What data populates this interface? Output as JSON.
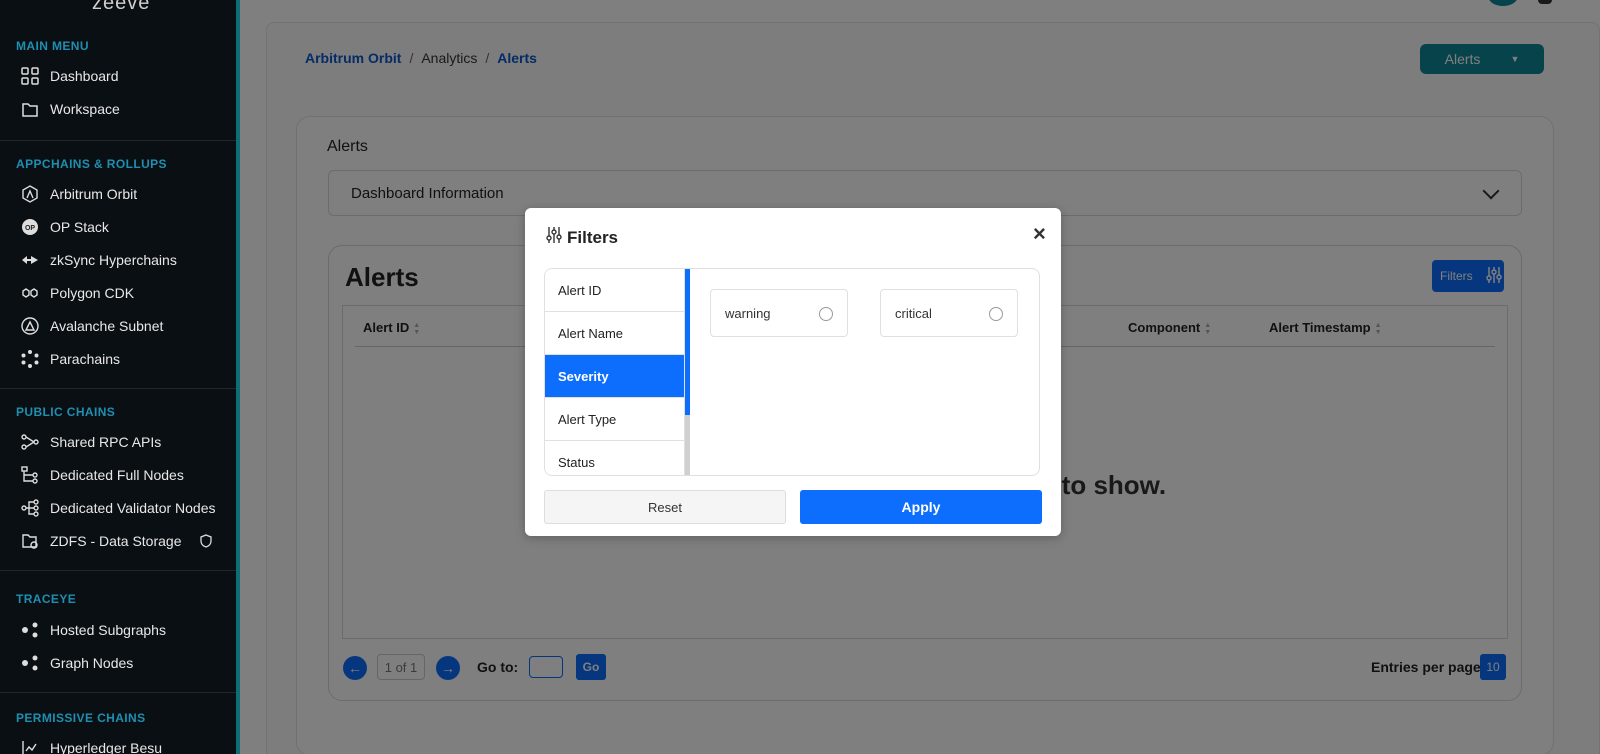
{
  "app": {
    "logo_text": "zeeve"
  },
  "sidebar": {
    "sections": [
      {
        "title": "MAIN MENU",
        "items": [
          {
            "label": "Dashboard",
            "icon": "grid-icon"
          },
          {
            "label": "Workspace",
            "icon": "folder-icon"
          }
        ]
      },
      {
        "title": "APPCHAINS & ROLLUPS",
        "items": [
          {
            "label": "Arbitrum Orbit",
            "icon": "arbitrum-icon"
          },
          {
            "label": "OP Stack",
            "icon": "op-icon"
          },
          {
            "label": "zkSync Hyperchains",
            "icon": "zksync-icon"
          },
          {
            "label": "Polygon CDK",
            "icon": "polygon-icon"
          },
          {
            "label": "Avalanche Subnet",
            "icon": "avalanche-icon"
          },
          {
            "label": "Parachains",
            "icon": "polkadot-icon"
          }
        ]
      },
      {
        "title": "PUBLIC CHAINS",
        "items": [
          {
            "label": "Shared RPC APIs",
            "icon": "rpc-icon"
          },
          {
            "label": "Dedicated Full Nodes",
            "icon": "full-nodes-icon"
          },
          {
            "label": "Dedicated Validator Nodes",
            "icon": "validator-icon"
          },
          {
            "label": "ZDFS - Data Storage",
            "icon": "storage-icon"
          }
        ]
      },
      {
        "title": "TRACEYE",
        "items": [
          {
            "label": "Hosted Subgraphs",
            "icon": "subgraph-icon"
          },
          {
            "label": "Graph Nodes",
            "icon": "graph-node-icon"
          }
        ]
      },
      {
        "title": "PERMISSIVE CHAINS",
        "items": [
          {
            "label": "Hyperledger Besu",
            "icon": "besu-icon"
          }
        ]
      }
    ]
  },
  "breadcrumb": {
    "item1": "Arbitrum Orbit",
    "sep": "/",
    "item2": "Analytics",
    "item3": "Alerts"
  },
  "header": {
    "dropdown_label": "Alerts"
  },
  "content": {
    "card_title": "Alerts",
    "accordion_label": "Dashboard Information",
    "alerts_heading": "Alerts",
    "filters_button": "Filters",
    "table_headers": [
      "Alert ID",
      "Component",
      "Alert Timestamp"
    ],
    "empty_text": "s to show."
  },
  "pagination": {
    "page_indicator": "1 of 1",
    "goto_label": "Go to:",
    "go_button": "Go",
    "entries_label": "Entries per page:",
    "entries_value": "10"
  },
  "modal": {
    "title": "Filters",
    "close": "×",
    "categories": [
      "Alert ID",
      "Alert Name",
      "Severity",
      "Alert Type",
      "Status"
    ],
    "active_category": "Severity",
    "options": [
      "warning",
      "critical"
    ],
    "reset_label": "Reset",
    "apply_label": "Apply"
  },
  "colors": {
    "accent": "#0d6efd",
    "teal": "#0f8796",
    "sidebar_bg": "#0a0f14",
    "section_title": "#1e8fb0"
  }
}
